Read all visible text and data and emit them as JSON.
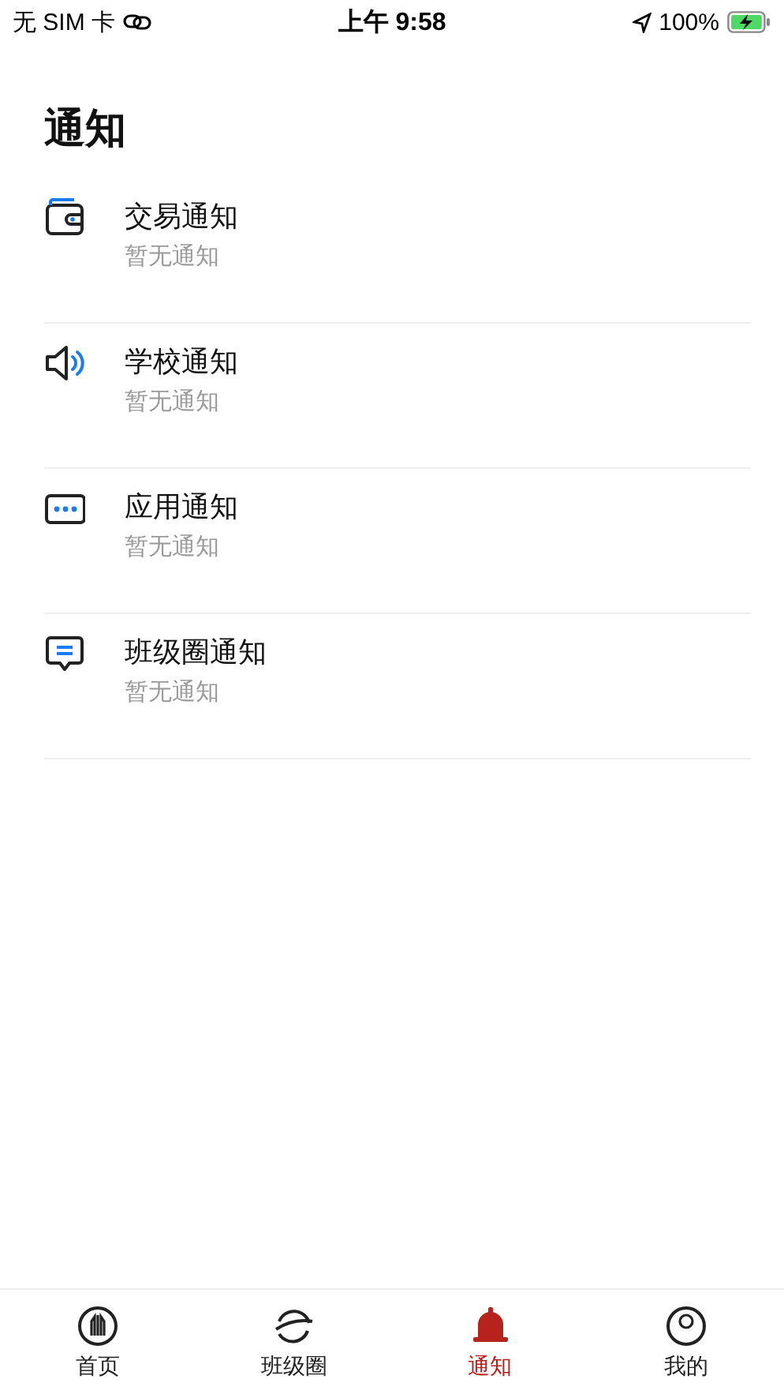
{
  "status_bar": {
    "carrier": "无 SIM 卡",
    "time": "上午 9:58",
    "battery": "100%"
  },
  "page_title": "通知",
  "notifications": [
    {
      "kind": "wallet",
      "title": "交易通知",
      "subtitle": "暂无通知"
    },
    {
      "kind": "speaker",
      "title": "学校通知",
      "subtitle": "暂无通知"
    },
    {
      "kind": "dots",
      "title": "应用通知",
      "subtitle": "暂无通知"
    },
    {
      "kind": "message",
      "title": "班级圈通知",
      "subtitle": "暂无通知"
    }
  ],
  "tab_bar": [
    {
      "kind": "home",
      "label": "首页",
      "selected": false
    },
    {
      "kind": "planet",
      "label": "班级圈",
      "selected": false
    },
    {
      "kind": "bell",
      "label": "通知",
      "selected": true
    },
    {
      "kind": "person",
      "label": "我的",
      "selected": false
    }
  ]
}
